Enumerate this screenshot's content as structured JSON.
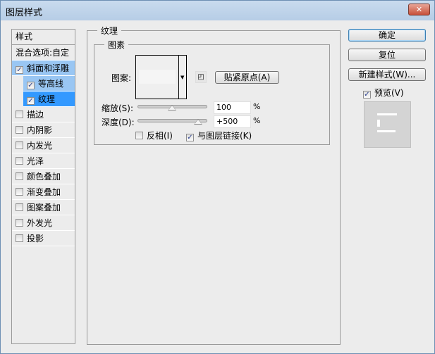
{
  "window": {
    "title": "图层样式",
    "close": "✕"
  },
  "sidebar": {
    "header": "样式",
    "blend": "混合选项:自定",
    "items": [
      {
        "label": "斜面和浮雕",
        "checked": true
      },
      {
        "label": "等高线",
        "checked": true
      },
      {
        "label": "纹理",
        "checked": true
      },
      {
        "label": "描边",
        "checked": false
      },
      {
        "label": "内阴影",
        "checked": false
      },
      {
        "label": "内发光",
        "checked": false
      },
      {
        "label": "光泽",
        "checked": false
      },
      {
        "label": "颜色叠加",
        "checked": false
      },
      {
        "label": "渐变叠加",
        "checked": false
      },
      {
        "label": "图案叠加",
        "checked": false
      },
      {
        "label": "外发光",
        "checked": false
      },
      {
        "label": "投影",
        "checked": false
      }
    ]
  },
  "panel": {
    "title": "纹理",
    "group": "图素",
    "pattern_label": "图案:",
    "snap_button": "贴紧原点(A)",
    "scale": {
      "label": "缩放(S):",
      "value": "100",
      "unit": "%",
      "slider_percent": 49
    },
    "depth": {
      "label": "深度(D):",
      "value": "+500",
      "unit": "%",
      "slider_percent": 87
    },
    "invert": {
      "label": "反相(I)",
      "checked": false
    },
    "link": {
      "label": "与图层链接(K)",
      "checked": true
    }
  },
  "buttons": {
    "ok": "确定",
    "reset": "复位",
    "new_style": "新建样式(W)..."
  },
  "preview": {
    "label": "预览(V)",
    "checked": true
  }
}
